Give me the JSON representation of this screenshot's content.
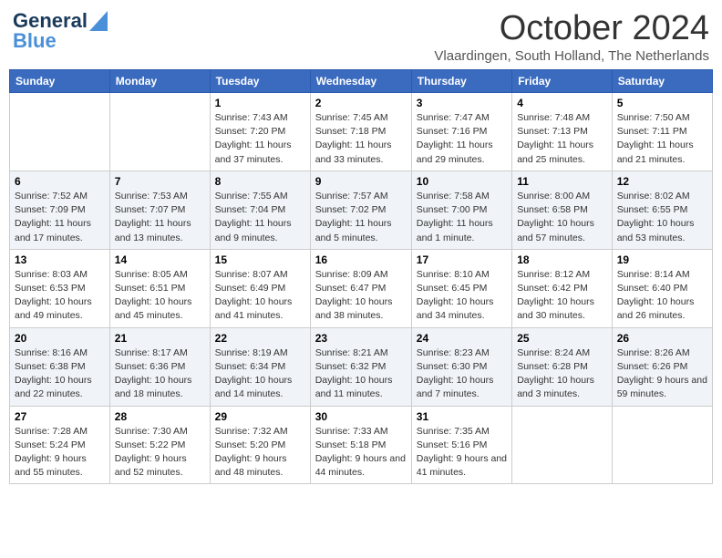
{
  "logo": {
    "line1": "General",
    "line2": "Blue"
  },
  "title": {
    "month": "October 2024",
    "location": "Vlaardingen, South Holland, The Netherlands"
  },
  "weekdays": [
    "Sunday",
    "Monday",
    "Tuesday",
    "Wednesday",
    "Thursday",
    "Friday",
    "Saturday"
  ],
  "rows": [
    [
      {
        "day": "",
        "sunrise": "",
        "sunset": "",
        "daylight": ""
      },
      {
        "day": "",
        "sunrise": "",
        "sunset": "",
        "daylight": ""
      },
      {
        "day": "1",
        "sunrise": "Sunrise: 7:43 AM",
        "sunset": "Sunset: 7:20 PM",
        "daylight": "Daylight: 11 hours and 37 minutes."
      },
      {
        "day": "2",
        "sunrise": "Sunrise: 7:45 AM",
        "sunset": "Sunset: 7:18 PM",
        "daylight": "Daylight: 11 hours and 33 minutes."
      },
      {
        "day": "3",
        "sunrise": "Sunrise: 7:47 AM",
        "sunset": "Sunset: 7:16 PM",
        "daylight": "Daylight: 11 hours and 29 minutes."
      },
      {
        "day": "4",
        "sunrise": "Sunrise: 7:48 AM",
        "sunset": "Sunset: 7:13 PM",
        "daylight": "Daylight: 11 hours and 25 minutes."
      },
      {
        "day": "5",
        "sunrise": "Sunrise: 7:50 AM",
        "sunset": "Sunset: 7:11 PM",
        "daylight": "Daylight: 11 hours and 21 minutes."
      }
    ],
    [
      {
        "day": "6",
        "sunrise": "Sunrise: 7:52 AM",
        "sunset": "Sunset: 7:09 PM",
        "daylight": "Daylight: 11 hours and 17 minutes."
      },
      {
        "day": "7",
        "sunrise": "Sunrise: 7:53 AM",
        "sunset": "Sunset: 7:07 PM",
        "daylight": "Daylight: 11 hours and 13 minutes."
      },
      {
        "day": "8",
        "sunrise": "Sunrise: 7:55 AM",
        "sunset": "Sunset: 7:04 PM",
        "daylight": "Daylight: 11 hours and 9 minutes."
      },
      {
        "day": "9",
        "sunrise": "Sunrise: 7:57 AM",
        "sunset": "Sunset: 7:02 PM",
        "daylight": "Daylight: 11 hours and 5 minutes."
      },
      {
        "day": "10",
        "sunrise": "Sunrise: 7:58 AM",
        "sunset": "Sunset: 7:00 PM",
        "daylight": "Daylight: 11 hours and 1 minute."
      },
      {
        "day": "11",
        "sunrise": "Sunrise: 8:00 AM",
        "sunset": "Sunset: 6:58 PM",
        "daylight": "Daylight: 10 hours and 57 minutes."
      },
      {
        "day": "12",
        "sunrise": "Sunrise: 8:02 AM",
        "sunset": "Sunset: 6:55 PM",
        "daylight": "Daylight: 10 hours and 53 minutes."
      }
    ],
    [
      {
        "day": "13",
        "sunrise": "Sunrise: 8:03 AM",
        "sunset": "Sunset: 6:53 PM",
        "daylight": "Daylight: 10 hours and 49 minutes."
      },
      {
        "day": "14",
        "sunrise": "Sunrise: 8:05 AM",
        "sunset": "Sunset: 6:51 PM",
        "daylight": "Daylight: 10 hours and 45 minutes."
      },
      {
        "day": "15",
        "sunrise": "Sunrise: 8:07 AM",
        "sunset": "Sunset: 6:49 PM",
        "daylight": "Daylight: 10 hours and 41 minutes."
      },
      {
        "day": "16",
        "sunrise": "Sunrise: 8:09 AM",
        "sunset": "Sunset: 6:47 PM",
        "daylight": "Daylight: 10 hours and 38 minutes."
      },
      {
        "day": "17",
        "sunrise": "Sunrise: 8:10 AM",
        "sunset": "Sunset: 6:45 PM",
        "daylight": "Daylight: 10 hours and 34 minutes."
      },
      {
        "day": "18",
        "sunrise": "Sunrise: 8:12 AM",
        "sunset": "Sunset: 6:42 PM",
        "daylight": "Daylight: 10 hours and 30 minutes."
      },
      {
        "day": "19",
        "sunrise": "Sunrise: 8:14 AM",
        "sunset": "Sunset: 6:40 PM",
        "daylight": "Daylight: 10 hours and 26 minutes."
      }
    ],
    [
      {
        "day": "20",
        "sunrise": "Sunrise: 8:16 AM",
        "sunset": "Sunset: 6:38 PM",
        "daylight": "Daylight: 10 hours and 22 minutes."
      },
      {
        "day": "21",
        "sunrise": "Sunrise: 8:17 AM",
        "sunset": "Sunset: 6:36 PM",
        "daylight": "Daylight: 10 hours and 18 minutes."
      },
      {
        "day": "22",
        "sunrise": "Sunrise: 8:19 AM",
        "sunset": "Sunset: 6:34 PM",
        "daylight": "Daylight: 10 hours and 14 minutes."
      },
      {
        "day": "23",
        "sunrise": "Sunrise: 8:21 AM",
        "sunset": "Sunset: 6:32 PM",
        "daylight": "Daylight: 10 hours and 11 minutes."
      },
      {
        "day": "24",
        "sunrise": "Sunrise: 8:23 AM",
        "sunset": "Sunset: 6:30 PM",
        "daylight": "Daylight: 10 hours and 7 minutes."
      },
      {
        "day": "25",
        "sunrise": "Sunrise: 8:24 AM",
        "sunset": "Sunset: 6:28 PM",
        "daylight": "Daylight: 10 hours and 3 minutes."
      },
      {
        "day": "26",
        "sunrise": "Sunrise: 8:26 AM",
        "sunset": "Sunset: 6:26 PM",
        "daylight": "Daylight: 9 hours and 59 minutes."
      }
    ],
    [
      {
        "day": "27",
        "sunrise": "Sunrise: 7:28 AM",
        "sunset": "Sunset: 5:24 PM",
        "daylight": "Daylight: 9 hours and 55 minutes."
      },
      {
        "day": "28",
        "sunrise": "Sunrise: 7:30 AM",
        "sunset": "Sunset: 5:22 PM",
        "daylight": "Daylight: 9 hours and 52 minutes."
      },
      {
        "day": "29",
        "sunrise": "Sunrise: 7:32 AM",
        "sunset": "Sunset: 5:20 PM",
        "daylight": "Daylight: 9 hours and 48 minutes."
      },
      {
        "day": "30",
        "sunrise": "Sunrise: 7:33 AM",
        "sunset": "Sunset: 5:18 PM",
        "daylight": "Daylight: 9 hours and 44 minutes."
      },
      {
        "day": "31",
        "sunrise": "Sunrise: 7:35 AM",
        "sunset": "Sunset: 5:16 PM",
        "daylight": "Daylight: 9 hours and 41 minutes."
      },
      {
        "day": "",
        "sunrise": "",
        "sunset": "",
        "daylight": ""
      },
      {
        "day": "",
        "sunrise": "",
        "sunset": "",
        "daylight": ""
      }
    ]
  ]
}
